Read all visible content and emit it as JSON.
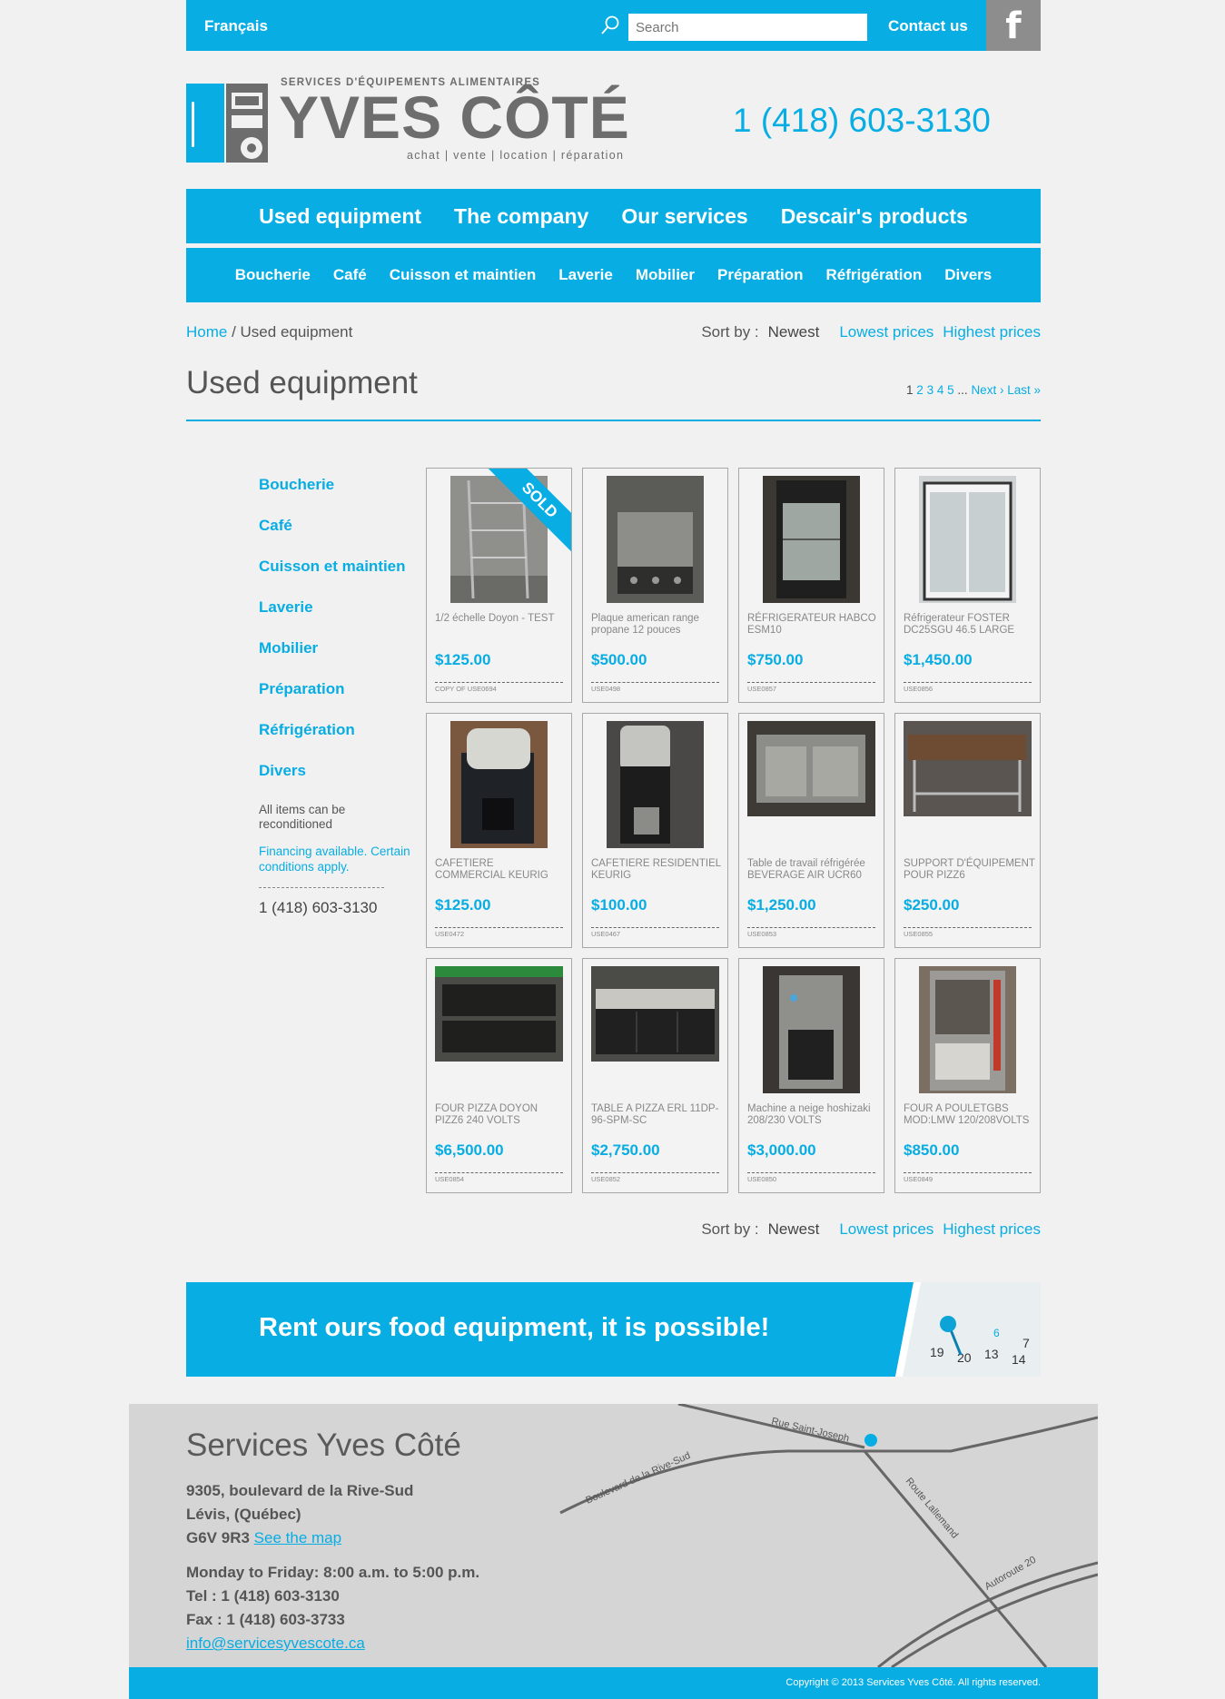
{
  "topbar": {
    "language": "Français",
    "search_placeholder": "Search",
    "contact": "Contact us",
    "facebook": "f"
  },
  "header": {
    "logo_sub": "SERVICES D'ÉQUIPEMENTS ALIMENTAIRES",
    "logo_main": "YVES CÔTÉ",
    "logo_tag": "achat | vente | location | réparation",
    "phone": "1 (418) 603-3130"
  },
  "main_nav": [
    "Used equipment",
    "The company",
    "Our services",
    "Descair's products"
  ],
  "sub_nav": [
    "Boucherie",
    "Café",
    "Cuisson et maintien",
    "Laverie",
    "Mobilier",
    "Préparation",
    "Réfrigération",
    "Divers"
  ],
  "breadcrumb": {
    "home": "Home",
    "separator": " / ",
    "current": "Used equipment"
  },
  "sort": {
    "label": "Sort by :",
    "newest": "Newest",
    "lowest": "Lowest prices",
    "highest": "Highest prices"
  },
  "page_title": "Used equipment",
  "pager": {
    "current": "1",
    "pages": [
      "2",
      "3",
      "4",
      "5"
    ],
    "ellipsis": "...",
    "next": "Next ›",
    "last": "Last »"
  },
  "sidebar": {
    "categories": [
      "Boucherie",
      "Café",
      "Cuisson et maintien",
      "Laverie",
      "Mobilier",
      "Préparation",
      "Réfrigération",
      "Divers"
    ],
    "reconditioned": "All items can be reconditioned",
    "financing": "Financing available. Certain conditions apply.",
    "phone": "1 (418) 603-3130"
  },
  "products": [
    {
      "name": "1/2 échelle Doyon - TEST",
      "price": "$125.00",
      "sku": "COPY OF USE0694",
      "badge": "SOLD"
    },
    {
      "name": "Plaque american range propane 12 pouces",
      "price": "$500.00",
      "sku": "USE0498",
      "badge": ""
    },
    {
      "name": "RÉFRIGERATEUR HABCO ESM10",
      "price": "$750.00",
      "sku": "USE0857",
      "badge": ""
    },
    {
      "name": "Réfrigerateur FOSTER DC25SGU 46.5 LARGE",
      "price": "$1,450.00",
      "sku": "USE0856",
      "badge": ""
    },
    {
      "name": "CAFETIERE COMMERCIAL KEURIG",
      "price": "$125.00",
      "sku": "USE0472",
      "badge": ""
    },
    {
      "name": "CAFETIERE RESIDENTIEL KEURIG",
      "price": "$100.00",
      "sku": "USE0467",
      "badge": ""
    },
    {
      "name": "Table de travail réfrigérée BEVERAGE AIR UCR60",
      "price": "$1,250.00",
      "sku": "USE0853",
      "badge": ""
    },
    {
      "name": "SUPPORT D'ÉQUIPEMENT POUR PIZZ6",
      "price": "$250.00",
      "sku": "USE0855",
      "badge": ""
    },
    {
      "name": "FOUR PIZZA DOYON PIZZ6 240 VOLTS",
      "price": "$6,500.00",
      "sku": "USE0854",
      "badge": ""
    },
    {
      "name": "TABLE A PIZZA ERL 11DP-96-SPM-SC",
      "price": "$2,750.00",
      "sku": "USE0852",
      "badge": ""
    },
    {
      "name": "Machine a neige hoshizaki 208/230 VOLTS",
      "price": "$3,000.00",
      "sku": "USE0850",
      "badge": ""
    },
    {
      "name": "FOUR A POULETGBS MOD:LMW 120/208VOLTS",
      "price": "$850.00",
      "sku": "USE0849",
      "badge": ""
    }
  ],
  "banner": {
    "text": "Rent ours food equipment, it is possible!"
  },
  "footer": {
    "company": "Services Yves Côté",
    "address1": "9305, boulevard de la Rive-Sud",
    "address2": "Lévis, (Québec)",
    "postal": "G6V 9R3",
    "map_link": "See the map",
    "hours": "Monday to Friday: 8:00 a.m. to 5:00 p.m.",
    "tel": "Tel :  1 (418) 603-3130",
    "fax": "Fax : 1 (418) 603-3733",
    "email": "info@servicesyvescote.ca",
    "copyright": "Copyright © 2013 Services Yves Côté. All rights reserved.",
    "map_streets": [
      "Rue Saint-Joseph",
      "Boulevard de la Rive-Sud",
      "Route Lallemand",
      "Autoroute 20"
    ]
  },
  "colors": {
    "accent": "#07ade3",
    "text": "#444444",
    "logo_gray": "#6d6d6e"
  }
}
